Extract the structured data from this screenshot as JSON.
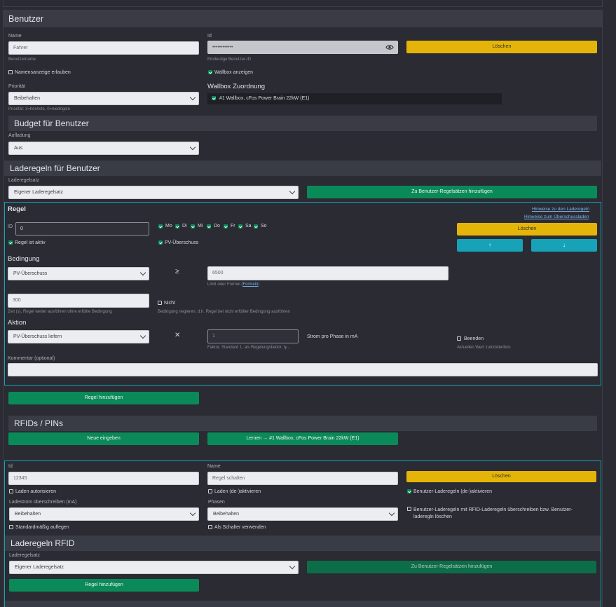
{
  "user_card": {
    "title": "Benutzer",
    "name": {
      "label": "Name",
      "value": "Fahrer",
      "hint": "Benutzername"
    },
    "id": {
      "label": "Id",
      "value": "••••••••••••",
      "hint": "Eindeutige Benutzer-ID"
    },
    "delete_label": "Löschen",
    "show_name_label": "Namensanzeige erlauben",
    "wallbox_show_label": "Wallbox anzeigen",
    "priority": {
      "label": "Priorität",
      "value": "Beibehalten",
      "hint": "Priorität: 3=höchste, 0=niedrigste"
    },
    "wallbox_assign": {
      "title": "Wallbox Zuordnung",
      "item": "#1 Wallbox, cFos Power Brain 22kW (E1)"
    }
  },
  "budget": {
    "title": "Budget für Benutzer",
    "charging": {
      "label": "Aufladung",
      "value": "Aus"
    }
  },
  "rules": {
    "title": "Laderegeln für Benutzer",
    "ruleset": {
      "label": "Laderegelsatz",
      "value": "Eigener Laderegelsatz"
    },
    "add_to_sets_label": "Zu Benutzer-Regelsätzen hinzufügen",
    "rule": {
      "title": "Regel",
      "link_rules": "Hinweise zu den Laderegeln",
      "link_surplus": "Hinweise zum Überschussladen",
      "id_label": "ID",
      "id_value": "0",
      "days": [
        "Mo",
        "Di",
        "Mi",
        "Do",
        "Fr",
        "Sa",
        "So"
      ],
      "active_label": "Regel ist aktiv",
      "pv_label": "PV-Überschuss",
      "delete_label": "Löschen",
      "up_arrow": "🡅",
      "down_arrow": "🡇",
      "condition": {
        "title": "Bedingung",
        "variable": "PV-Überschuss",
        "operator": "≥",
        "value": "6500",
        "value_hint_prefix": "Limit oder Formel (",
        "value_hint_link": "Formeln",
        "value_hint_suffix": ")",
        "time": "300",
        "time_hint": "Zeit (s), Regel weiter ausführen ohne erfüllte Bedingung",
        "not_label": "Nicht",
        "not_hint": "Bedingung negieren, d.h. Regel bei nicht erfüllter Bedingung ausführen"
      },
      "action": {
        "title": "Aktion",
        "variable": "PV-Überschuss liefern",
        "operator": "✕",
        "factor_placeholder": "1",
        "factor_hint": "Faktor, Standard 1, als Regelungsfaktor, ty...",
        "unit": "Strom pro Phase in mA",
        "end_label": "Beenden",
        "end_hint": "Aktuellen Wert zurücklierfern"
      },
      "comment_label": "Kommentar (optional)",
      "comment_value": ""
    },
    "add_rule_label": "Regel hinzufügen"
  },
  "rfid": {
    "title": "RFIDs / PINs",
    "new_label": "Neue eingeben",
    "learn_label": "Lernen → #1 Wallbox, cFos Power Brain 22kW (E1)",
    "entry": {
      "id_label": "Id",
      "id_value": "12345",
      "name_label": "Name",
      "name_value": "Regel schalten",
      "delete_label": "Löschen",
      "auth_label": "Laden autorisieren",
      "toggle_label": "Laden (de-)aktivieren",
      "user_rules_toggle_label": "Benutzer-Laderegeln (de-)aktivieren",
      "current_label": "Ladestrom überschreiben (mA)",
      "current_value": "Beibehalten",
      "phases_label": "Phasen",
      "phases_value": "Beibehalten",
      "override_label": "Benutzer-Laderegeln mit RFID-Laderegeln überschreiben bzw. Benutzer-laderegln löschen",
      "default_label": "Standardmäßig auflegen",
      "switch_label": "Als Schalter verwenden"
    },
    "rules_title": "Laderegeln RFID",
    "ruleset": {
      "label": "Laderegelsatz",
      "value": "Eigener Laderegelsatz"
    },
    "add_to_sets_label": "Zu Benutzer-Regelsätzen hinzufügen",
    "add_rule_label": "Regel hinzufügen"
  },
  "colors": {
    "accent_green": "#0a8a58",
    "warning_yellow": "#e5b408",
    "info_teal": "#17a2b8",
    "panel": "#2a2b33"
  }
}
